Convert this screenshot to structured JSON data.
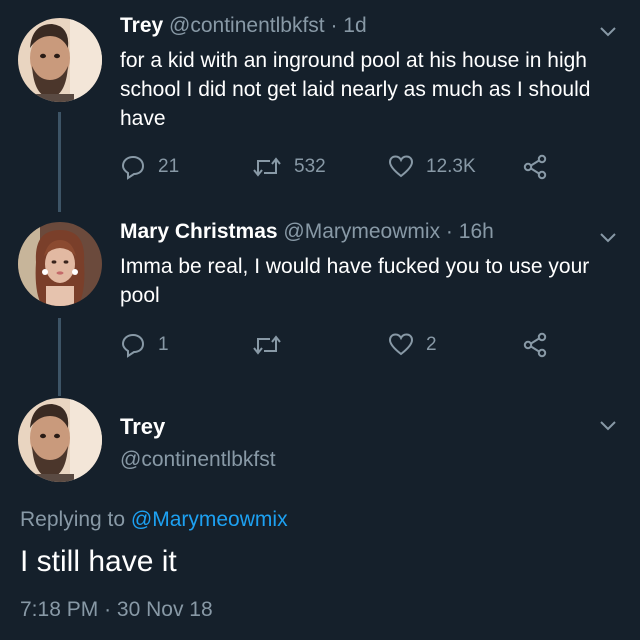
{
  "tweet1": {
    "name": "Trey",
    "handle": "@continentlbkfst",
    "time": "1d",
    "text": "for a kid with an inground pool at his house in high school I did not get laid nearly as much as I should have",
    "replies": "21",
    "retweets": "532",
    "likes": "12.3K"
  },
  "tweet2": {
    "name": "Mary Christmas",
    "handle": "@Marymeowmix",
    "time": "16h",
    "text": "Imma be real, I would have fucked you to use your pool",
    "replies": "1",
    "retweets": "",
    "likes": "2"
  },
  "main": {
    "name": "Trey",
    "handle": "@continentlbkfst",
    "replying_prefix": "Replying to",
    "replying_to": "@Marymeowmix",
    "text": "I still have it",
    "time": "7:18 PM",
    "date": "30 Nov 18"
  },
  "separator": "·",
  "icons": {
    "reply": "reply-icon",
    "retweet": "retweet-icon",
    "like": "heart-icon",
    "share": "share-icon",
    "more": "chevron-down-icon"
  },
  "colors": {
    "background": "#15202b",
    "muted": "#8899a6",
    "link": "#1da1f2",
    "thread_line": "#3d5466"
  }
}
